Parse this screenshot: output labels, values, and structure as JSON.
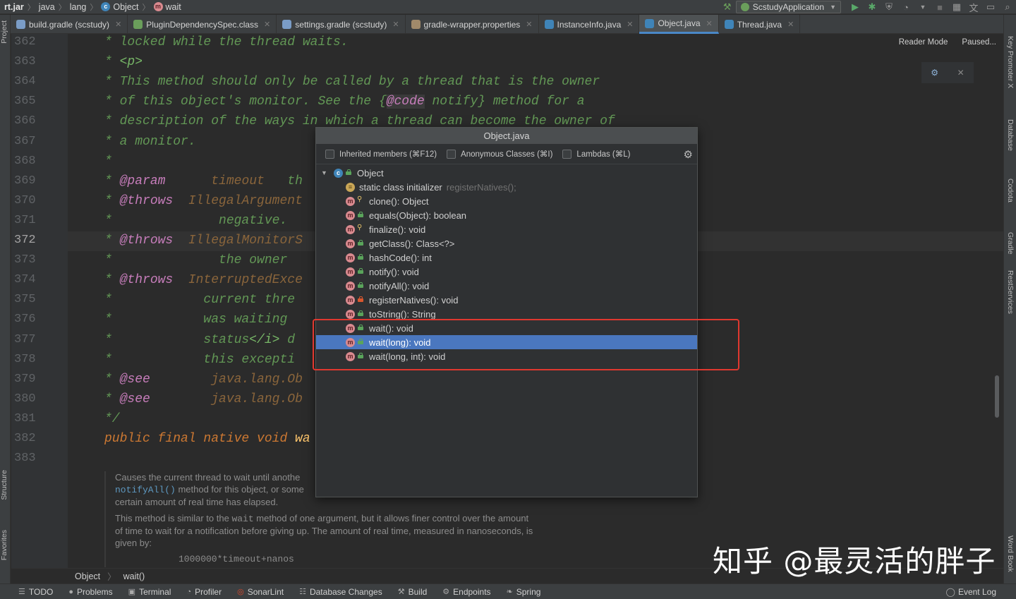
{
  "navbar": {
    "crumbs": [
      "rt.jar",
      "java",
      "lang",
      "Object",
      "wait"
    ],
    "run_config": "ScstudyApplication"
  },
  "tabs": [
    {
      "label": "build.gradle (scstudy)",
      "icon_color": "#7a9cc6"
    },
    {
      "label": "PluginDependencySpec.class",
      "icon_color": "#6a9e5b"
    },
    {
      "label": "settings.gradle (scstudy)",
      "icon_color": "#7a9cc6"
    },
    {
      "label": "gradle-wrapper.properties",
      "icon_color": "#a0896a"
    },
    {
      "label": "InstanceInfo.java",
      "icon_color": "#3f84b8"
    },
    {
      "label": "Object.java",
      "icon_color": "#3f84b8",
      "active": true
    },
    {
      "label": "Thread.java",
      "icon_color": "#3f84b8"
    }
  ],
  "side": {
    "left": [
      "Project",
      "Structure",
      "Favorites"
    ],
    "right": [
      "Key Promoter X",
      "Database",
      "Codota",
      "Gradle",
      "RestServices",
      "Word Book"
    ]
  },
  "reader": {
    "mode": "Reader Mode",
    "paused": "Paused..."
  },
  "editor": {
    "current_line": "372",
    "lines": [
      {
        "no": "362",
        "text": "* locked while the thread waits."
      },
      {
        "no": "363",
        "text": "* <p>"
      },
      {
        "no": "364",
        "text": "* This method should only be called by a thread that is the owner"
      },
      {
        "no": "365",
        "text": "* of this object's monitor. See the {@code notify} method for a"
      },
      {
        "no": "366",
        "text": "* description of the ways in which a thread can become the owner of"
      },
      {
        "no": "367",
        "text": "* a monitor."
      },
      {
        "no": "368",
        "text": "*"
      },
      {
        "no": "369",
        "text": "* @param      timeout   th"
      },
      {
        "no": "370",
        "text": "* @throws  IllegalArgument"
      },
      {
        "no": "371",
        "text": "*              negative."
      },
      {
        "no": "372",
        "text": "* @throws  IllegalMonitorS"
      },
      {
        "no": "373",
        "text": "*              the owner"
      },
      {
        "no": "374",
        "text": "* @throws  InterruptedExce"
      },
      {
        "no": "375",
        "text": "*            current thre"
      },
      {
        "no": "376",
        "text": "*            was waiting"
      },
      {
        "no": "377",
        "text": "*            status</i> d"
      },
      {
        "no": "378",
        "text": "*            this excepti"
      },
      {
        "no": "379",
        "text": "* @see        java.lang.Ob"
      },
      {
        "no": "380",
        "text": "* @see        java.lang.Ob"
      },
      {
        "no": "381",
        "text": "*/"
      },
      {
        "no": "382",
        "text": "public final native void wa"
      },
      {
        "no": "383",
        "text": ""
      }
    ]
  },
  "doc": {
    "p1_a": "Causes the current thread to wait until anothe",
    "p1_code": "notifyAll()",
    "p1_b": " method for this object, or some",
    "p1_c": "certain amount of real time has elapsed.",
    "p2_a": "This method is similar to the ",
    "p2_code": "wait",
    "p2_b": " method of one argument, but it allows finer control over the amount of time to wait for a notification before giving up. The amount of real time, measured in nanoseconds, is given by:",
    "formula": "1000000*timeout+nanos"
  },
  "popup": {
    "title": "Object.java",
    "filters": [
      "Inherited members (⌘F12)",
      "Anonymous Classes (⌘I)",
      "Lambdas (⌘L)"
    ],
    "root": "Object",
    "items": [
      {
        "icon": "static",
        "vis": "none",
        "label": "static class initializer",
        "extra": "registerNatives();"
      },
      {
        "icon": "m",
        "vis": "prot",
        "label": "clone(): Object"
      },
      {
        "icon": "m",
        "vis": "pub",
        "label": "equals(Object): boolean"
      },
      {
        "icon": "m",
        "vis": "prot",
        "label": "finalize(): void"
      },
      {
        "icon": "m",
        "vis": "pub",
        "label": "getClass(): Class<?>"
      },
      {
        "icon": "m",
        "vis": "pub",
        "label": "hashCode(): int"
      },
      {
        "icon": "m",
        "vis": "pub",
        "label": "notify(): void"
      },
      {
        "icon": "m",
        "vis": "pub",
        "label": "notifyAll(): void"
      },
      {
        "icon": "m",
        "vis": "priv",
        "label": "registerNatives(): void"
      },
      {
        "icon": "m",
        "vis": "pub",
        "label": "toString(): String"
      },
      {
        "icon": "m",
        "vis": "pub",
        "label": "wait(): void"
      },
      {
        "icon": "m",
        "vis": "pub",
        "label": "wait(long): void",
        "selected": true
      },
      {
        "icon": "m",
        "vis": "pub",
        "label": "wait(long, int): void"
      }
    ]
  },
  "editor_crumb": [
    "Object",
    "wait()"
  ],
  "bottombar": {
    "items": [
      "TODO",
      "Problems",
      "Terminal",
      "Profiler",
      "SonarLint",
      "Database Changes",
      "Build",
      "Endpoints",
      "Spring"
    ],
    "right": "Event Log"
  },
  "watermark": "知乎 @最灵活的胖子"
}
